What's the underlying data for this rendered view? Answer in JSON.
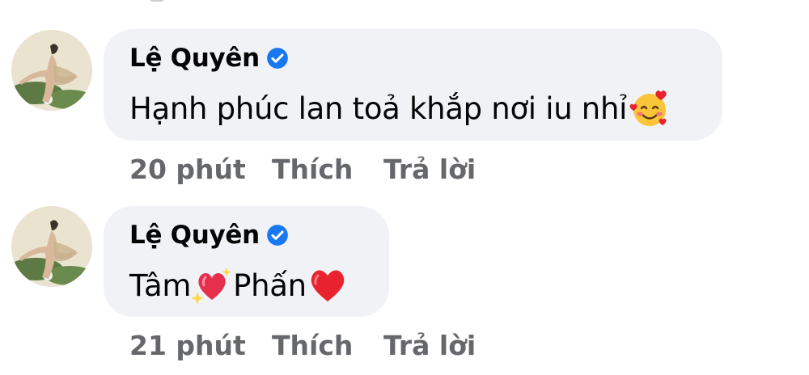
{
  "comments": [
    {
      "author": "Lệ Quyên",
      "verified": true,
      "text": "Hạnh phúc lan toả khắp nơi iu nhỉ",
      "text_emoji": "smiling-face-with-hearts-icon",
      "time": "20 phút",
      "like_label": "Thích",
      "reply_label": "Trả lời"
    },
    {
      "author": "Lệ Quyên",
      "verified": true,
      "text_part1": "Tâm",
      "text_emoji1": "sparkling-heart-icon",
      "text_part2": "Phấn",
      "text_emoji2": "red-heart-icon",
      "time": "21 phút",
      "like_label": "Thích",
      "reply_label": "Trả lời"
    }
  ],
  "colors": {
    "bubble": "#f0f2f5",
    "verified_badge": "#1877f2",
    "action_text": "#65676b"
  }
}
